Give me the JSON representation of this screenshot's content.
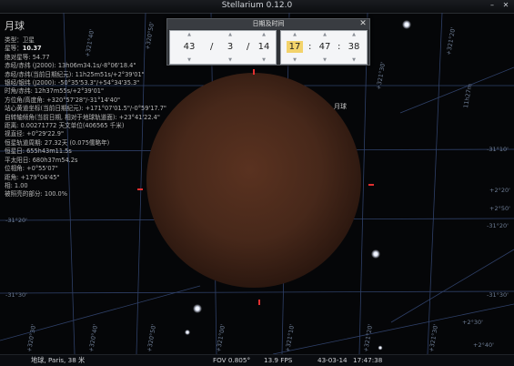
{
  "window": {
    "title": "Stellarium 0.12.0",
    "minimize_glyph": "–",
    "close_glyph": "✕"
  },
  "info": {
    "name": "月球",
    "rows": [
      {
        "label": "",
        "text": "类型：卫星"
      },
      {
        "label": "星等：",
        "text": "10.37"
      },
      {
        "label": "",
        "text": "绝对星等: 54.77"
      },
      {
        "label": "",
        "text": "赤经/赤纬 (J2000): 13h06m34.1s/-8°06'18.4\""
      },
      {
        "label": "",
        "text": "赤经/赤纬(当前日期纪元): 11h25m51s/+2°39'01\""
      },
      {
        "label": "",
        "text": "银经/银纬 (J2000): -50°35'53.3\"/+54°34'35.3\""
      },
      {
        "label": "",
        "text": "时角/赤纬: 12h37m55s/+2°39'01\""
      },
      {
        "label": "",
        "text": "方位角/高度角: +320°57'28\"/-31°14'40\""
      },
      {
        "label": "",
        "text": "站心黄道坐标(当前日期纪元): +171°07'01.5\"/-0°59'17.7\""
      },
      {
        "label": "",
        "text": "自转轴倾角(当前日期, 相对于地球轨道面): +23°41'22.4\""
      },
      {
        "label": "",
        "text": "距离: 0.00271772 天文单位(406565 千米)"
      },
      {
        "label": "",
        "text": "视直径: +0°29'22.9\""
      },
      {
        "label": "",
        "text": "恒星轨道周期: 27.32天 (0.075儒略年)"
      },
      {
        "label": "",
        "text": "恒星日: 655h43m11.5s"
      },
      {
        "label": "",
        "text": "平太阳日: 680h37m54.2s"
      },
      {
        "label": "",
        "text": "位相角: +0°55'07\""
      },
      {
        "label": "",
        "text": "距角: +179°04'45\""
      },
      {
        "label": "",
        "text": "相: 1.00"
      },
      {
        "label": "",
        "text": "被照亮的部分: 100.0%"
      }
    ]
  },
  "sky": {
    "moon_label": "月球",
    "grid_labels": {
      "left_1": "-31°20'",
      "left_2": "-31°30'",
      "right_1": "-31°10'",
      "right_2": "+2°50'",
      "right_3": "-31°20'",
      "top_1": "+321°40'",
      "top_2": "+320°50'",
      "top_3": "+321°20'",
      "top_4": "+321°30'",
      "top_5": "11h27m",
      "bot_1": "+320°30'",
      "bot_2": "+320°40'",
      "bot_3": "+320°50'",
      "bot_4": "+321°00'",
      "bot_5": "+321°10'",
      "bot_6": "+321°20'",
      "bot_7": "+321°30'",
      "bot_8": "+2°30'",
      "bot_9": "+2°40'",
      "right_4": "+2°20'",
      "right_5": "-31°30'"
    }
  },
  "datetime_dialog": {
    "title": "日期及时间",
    "close_glyph": "✕",
    "arrow_up": "▲",
    "arrow_down": "▼",
    "year": "43",
    "month": "3",
    "day": "14",
    "hour": "17",
    "minute": "47",
    "second": "38",
    "date_sep": "/",
    "time_sep": ":"
  },
  "status": {
    "location": "地球, Paris, 38 米",
    "fov": "FOV 0.805°",
    "fps": "13.9 FPS",
    "date": "43-03-14",
    "time": "17:47:38"
  },
  "colors": {
    "moon_dark": "#3a1f14",
    "moon_mid": "#5d3320",
    "grid": "#2d3d63",
    "marker": "#e23030"
  }
}
